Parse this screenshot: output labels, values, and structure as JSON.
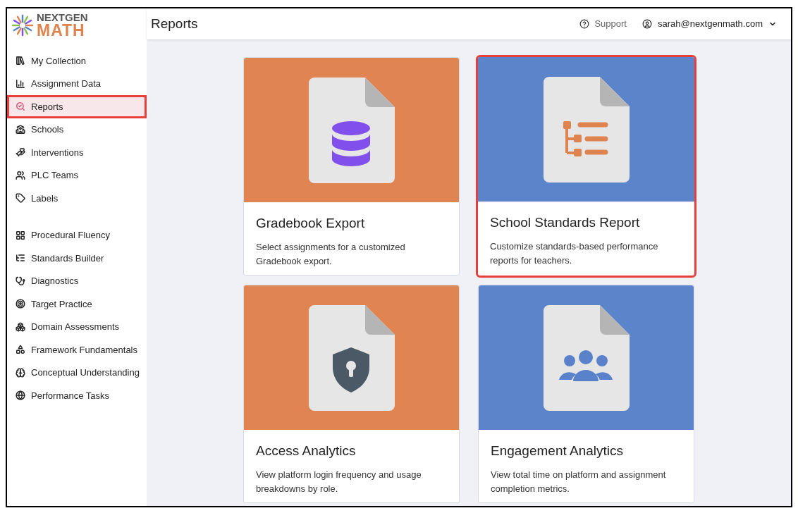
{
  "logo": {
    "line_1": "NEXTGEN",
    "line_2": "MATH"
  },
  "header": {
    "title": "Reports",
    "support": "Support",
    "account": "sarah@nextgenmath.com"
  },
  "sidebar": {
    "groups": [
      [
        {
          "label": "My Collection",
          "selected": false,
          "highlighted": false
        },
        {
          "label": "Assignment Data",
          "selected": false,
          "highlighted": false
        },
        {
          "label": "Reports",
          "selected": true,
          "highlighted": true
        },
        {
          "label": "Schools",
          "selected": false,
          "highlighted": false
        },
        {
          "label": "Interventions",
          "selected": false,
          "highlighted": false
        },
        {
          "label": "PLC Teams",
          "selected": false,
          "highlighted": false
        },
        {
          "label": "Labels",
          "selected": false,
          "highlighted": false
        }
      ],
      [
        {
          "label": "Procedural Fluency",
          "selected": false,
          "highlighted": false
        },
        {
          "label": "Standards Builder",
          "selected": false,
          "highlighted": false
        },
        {
          "label": "Diagnostics",
          "selected": false,
          "highlighted": false
        },
        {
          "label": "Target Practice",
          "selected": false,
          "highlighted": false
        },
        {
          "label": "Domain Assessments",
          "selected": false,
          "highlighted": false
        },
        {
          "label": "Framework Fundamentals",
          "selected": false,
          "highlighted": false
        },
        {
          "label": "Conceptual Understanding",
          "selected": false,
          "highlighted": false
        },
        {
          "label": "Performance Tasks",
          "selected": false,
          "highlighted": false
        }
      ]
    ]
  },
  "cards": [
    {
      "title": "Gradebook Export",
      "description": "Select assignments for a customized Gradebook export.",
      "color": "#e08552",
      "highlighted": false
    },
    {
      "title": "School Standards Report",
      "description": "Customize standards-based performance reports for teachers.",
      "color": "#5b84cb",
      "highlighted": true
    },
    {
      "title": "Access Analytics",
      "description": "View platform login frequency and usage breakdowns by role.",
      "color": "#e08552",
      "highlighted": false
    },
    {
      "title": "Engagement Analytics",
      "description": "View total time on platform and assignment completion metrics.",
      "color": "#5b84cb",
      "highlighted": false
    }
  ]
}
